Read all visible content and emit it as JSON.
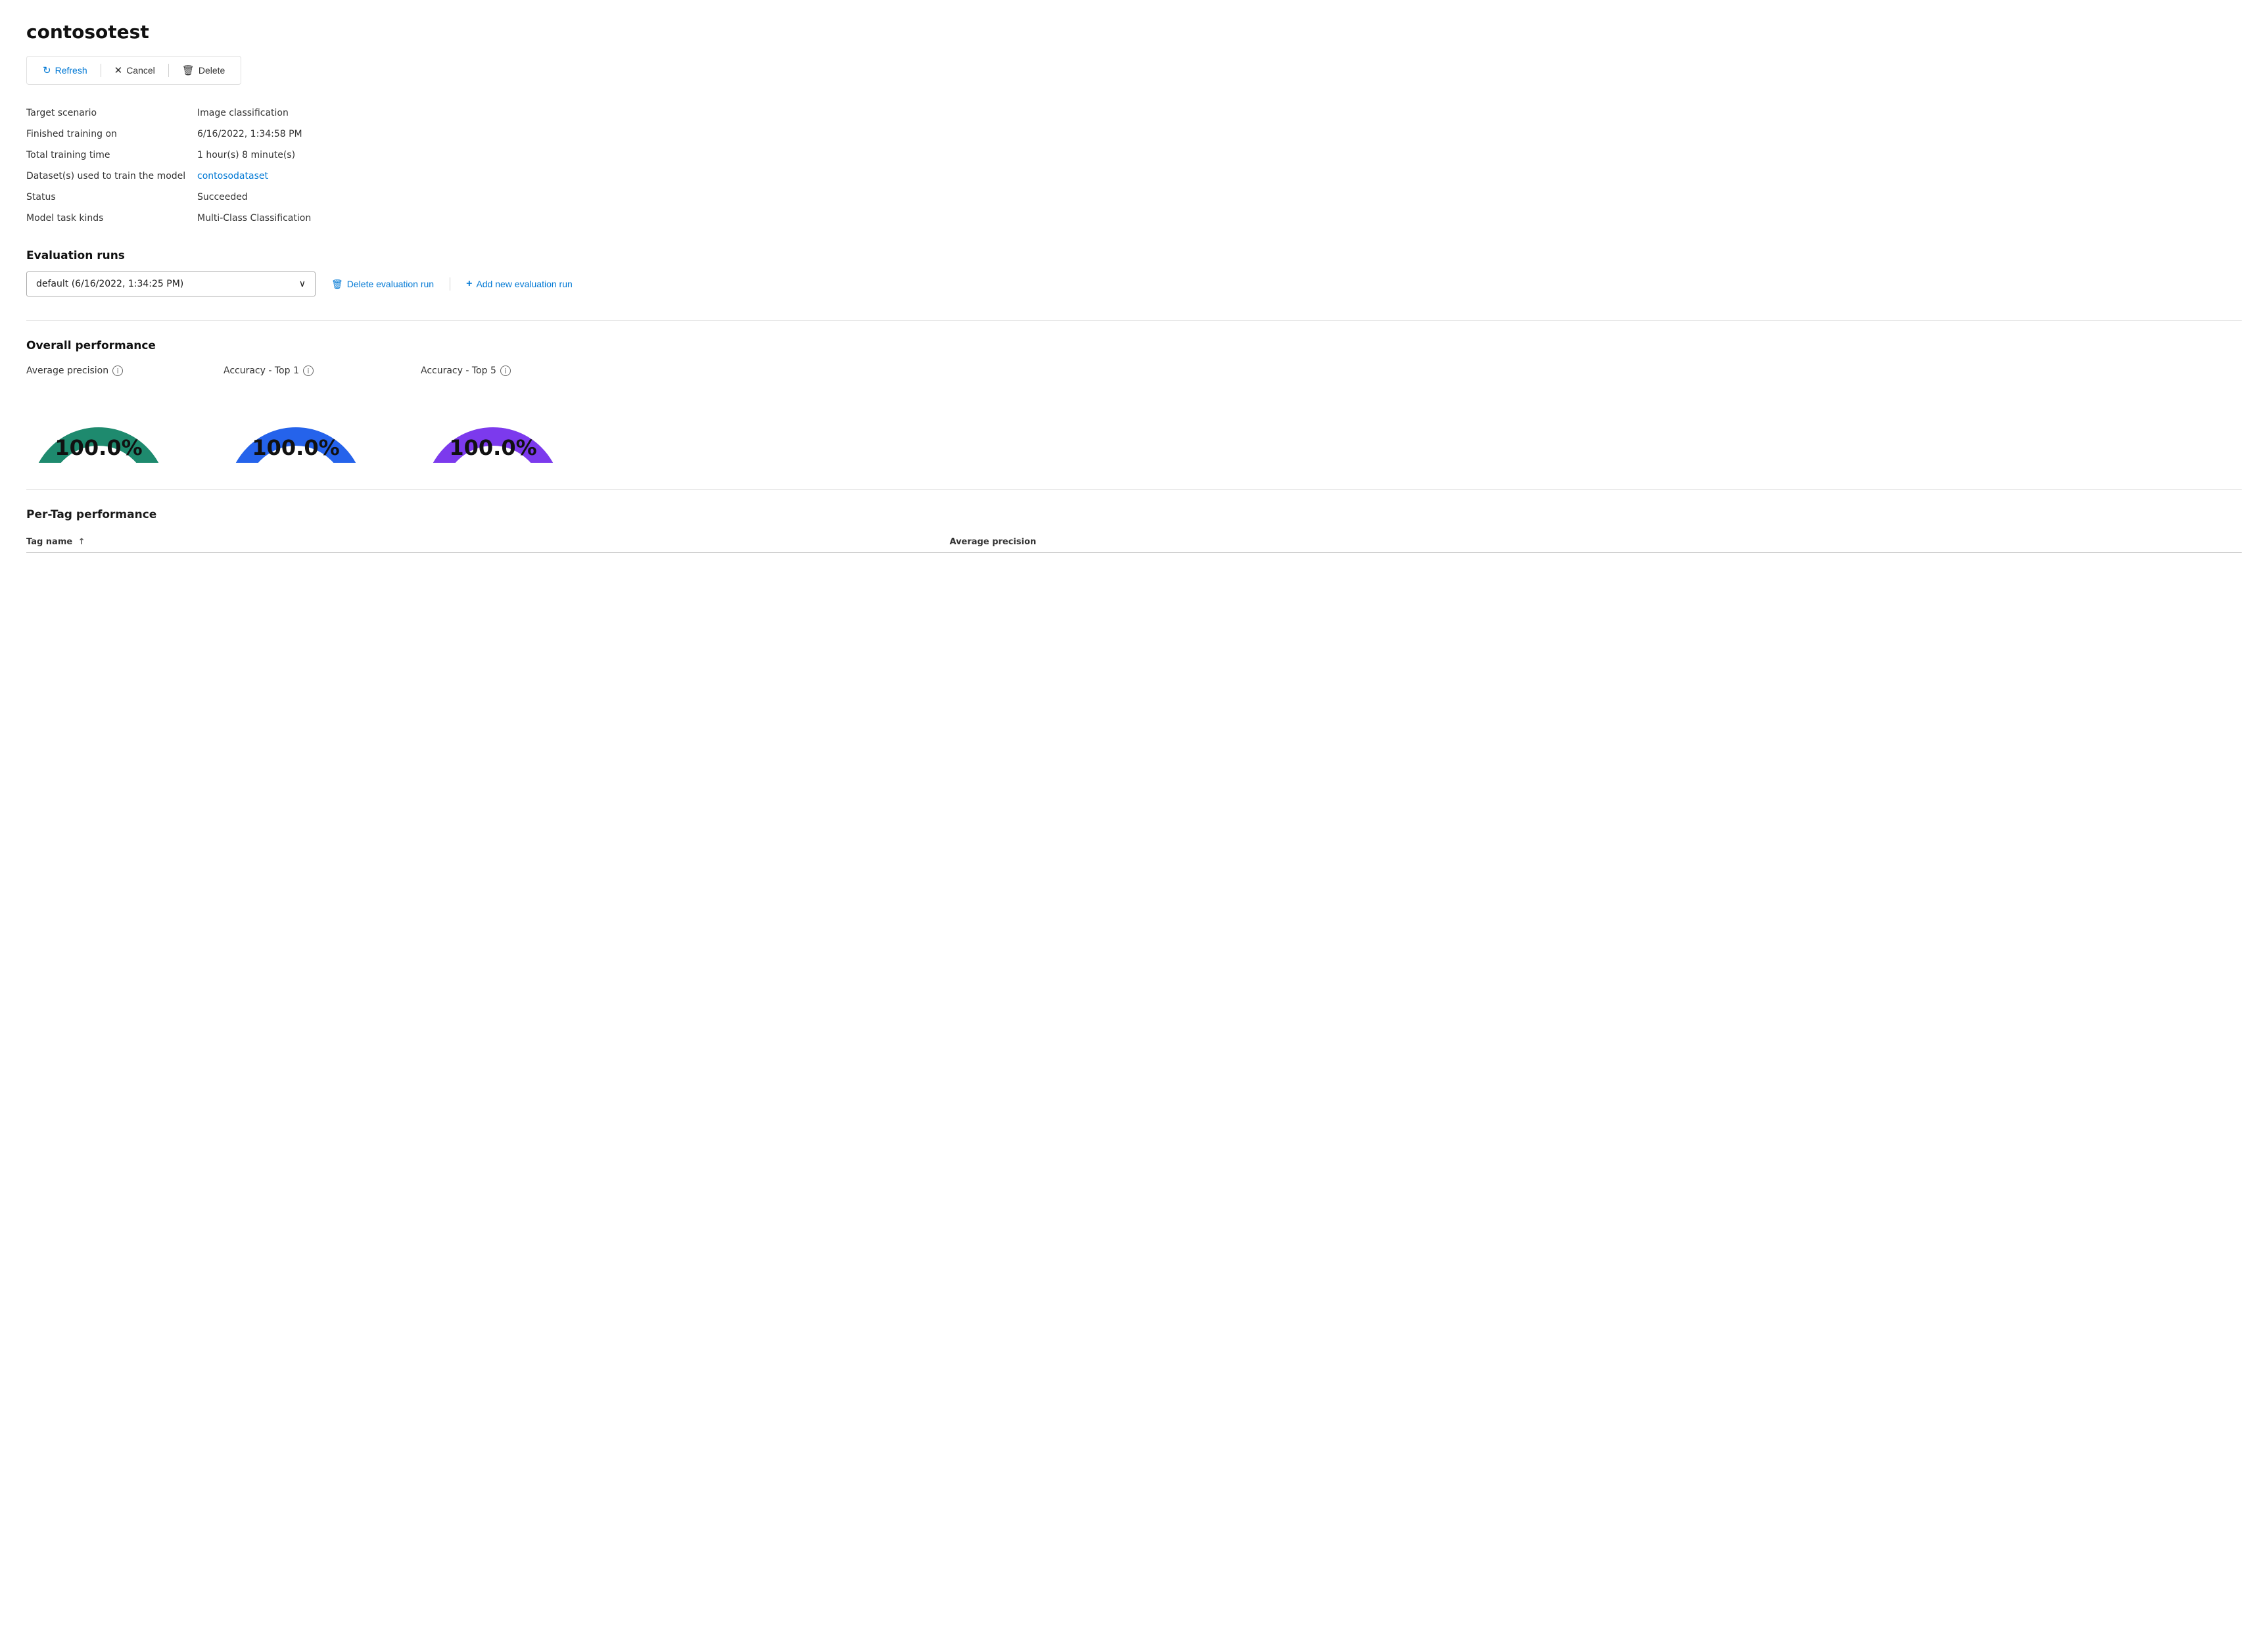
{
  "page": {
    "title": "contosotest"
  },
  "toolbar": {
    "refresh_label": "Refresh",
    "cancel_label": "Cancel",
    "delete_label": "Delete"
  },
  "info": {
    "fields": [
      {
        "label": "Target scenario",
        "value": "Image classification",
        "type": "text"
      },
      {
        "label": "Finished training on",
        "value": "6/16/2022, 1:34:58 PM",
        "type": "text"
      },
      {
        "label": "Total training time",
        "value": "1 hour(s) 8 minute(s)",
        "type": "text"
      },
      {
        "label": "Dataset(s) used to train the model",
        "value": "contosodataset",
        "type": "link"
      },
      {
        "label": "Status",
        "value": "Succeeded",
        "type": "text"
      },
      {
        "label": "Model task kinds",
        "value": "Multi-Class Classification",
        "type": "text"
      }
    ]
  },
  "evaluation_runs": {
    "section_title": "Evaluation runs",
    "dropdown_value": "default (6/16/2022, 1:34:25 PM)",
    "delete_label": "Delete evaluation run",
    "add_label": "Add new evaluation run"
  },
  "overall_performance": {
    "section_title": "Overall performance",
    "gauges": [
      {
        "label": "Average precision",
        "value": "100.0%",
        "color": "#1e8a6e",
        "id": "gauge-avg-precision"
      },
      {
        "label": "Accuracy - Top 1",
        "value": "100.0%",
        "color": "#2563eb",
        "id": "gauge-acc-top1"
      },
      {
        "label": "Accuracy - Top 5",
        "value": "100.0%",
        "color": "#7c3aed",
        "id": "gauge-acc-top5"
      }
    ]
  },
  "per_tag_performance": {
    "section_title": "Per-Tag performance",
    "columns": [
      {
        "label": "Tag name",
        "sortable": true,
        "sort_direction": "asc"
      },
      {
        "label": "Average precision",
        "sortable": false
      }
    ]
  }
}
